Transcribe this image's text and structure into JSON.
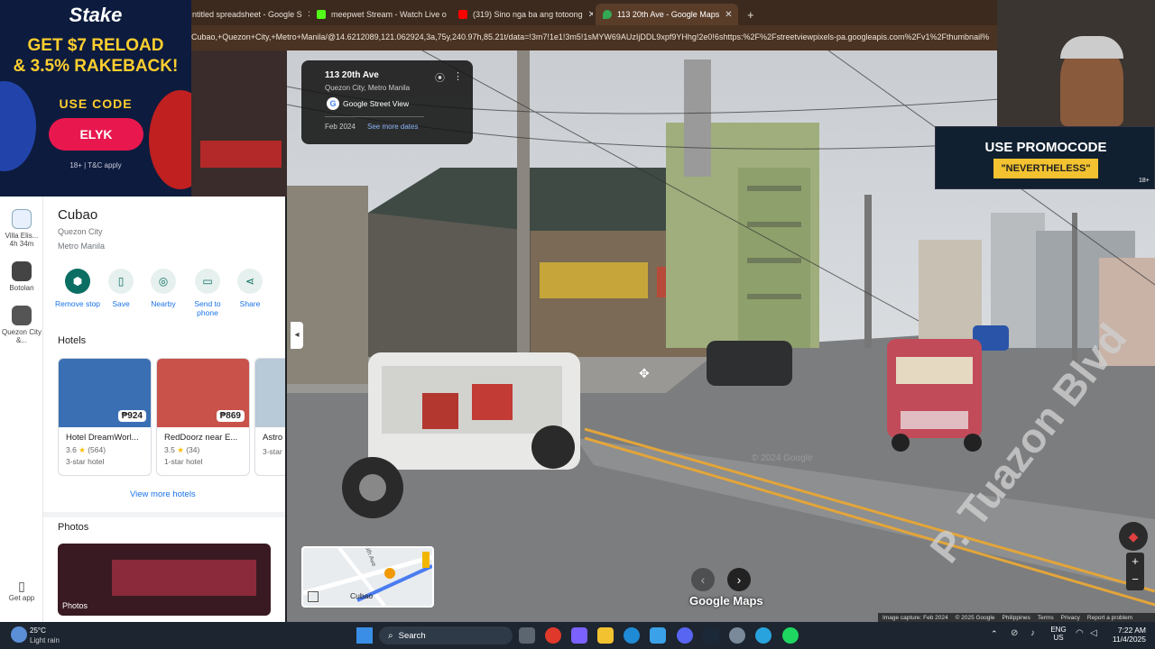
{
  "browser": {
    "tabs": [
      {
        "label": "ntitled spreadsheet - Google S",
        "active": false
      },
      {
        "label": "meepwet Stream - Watch Live o",
        "active": false
      },
      {
        "label": "(319) Sino nga ba ang totoong",
        "active": false
      },
      {
        "label": "113 20th Ave - Google Maps",
        "active": true
      }
    ],
    "new_tab": "+",
    "url": "Cubao,+Quezon+City,+Metro+Manila/@14.6212089,121.062924,3a,75y,240.97h,85.21t/data=!3m7!1e1!3m5!1sMYW69AUzIjDDL9xpf9YHhg!2e0!6shttps:%2F%2Fstreetviewpixels-pa.googleapis.com%2Fv1%2Fthumbnail%"
  },
  "ad": {
    "brand": "Stake",
    "line1": "GET $7 RELOAD",
    "line2": "& 3.5% RAKEBACK!",
    "use_code": "USE CODE",
    "code": "ELYK",
    "fine": "18+ | T&C apply"
  },
  "rail": {
    "items": [
      {
        "label": "Villa Elis...",
        "sub": "4h 34m"
      },
      {
        "label": "Botolan",
        "sub": ""
      },
      {
        "label": "Quezon City &...",
        "sub": ""
      }
    ],
    "get_app": "Get app"
  },
  "place": {
    "title": "Cubao",
    "line1": "Quezon City",
    "line2": "Metro Manila"
  },
  "actions": [
    {
      "label": "Remove stop"
    },
    {
      "label": "Save"
    },
    {
      "label": "Nearby"
    },
    {
      "label": "Send to phone"
    },
    {
      "label": "Share"
    }
  ],
  "hotels": {
    "heading": "Hotels",
    "cards": [
      {
        "name": "Hotel DreamWorl...",
        "rating": "3.6",
        "reviews": "(564)",
        "class": "3-star hotel",
        "price": "₱924",
        "color": "#3b6fb3"
      },
      {
        "name": "RedDoorz near E...",
        "rating": "3.5",
        "reviews": "(34)",
        "class": "1-star hotel",
        "price": "₱869",
        "color": "#c9524b"
      },
      {
        "name": "Astro",
        "rating": "",
        "reviews": "",
        "class": "3-star",
        "price": "",
        "color": "#b8c9d8"
      }
    ],
    "view_more": "View more hotels"
  },
  "photos": {
    "heading": "Photos",
    "caption": "Photos"
  },
  "streetview": {
    "address": "113 20th Ave",
    "locality": "Quezon City, Metro Manila",
    "source": "Google Street View",
    "date": "Feb 2024",
    "see_more": "See more dates",
    "street_label": "P. Tuazon Blvd",
    "watermark": "© 2024 Google",
    "brand": "Google Maps",
    "minimap_label": "Cubao",
    "minimap_street": "15th Ave",
    "footer": [
      "Image capture: Feb 2024",
      "© 2025 Google",
      "Philippines",
      "Terms",
      "Privacy",
      "Report a problem"
    ],
    "zoom_in": "+",
    "zoom_out": "−"
  },
  "overlays": {
    "promo_line1": "USE PROMOCODE",
    "promo_line2": "\"NEVERTHELESS\"",
    "promo_badge": "18+"
  },
  "taskbar": {
    "weather_temp": "25°C",
    "weather_desc": "Light rain",
    "search": "Search",
    "lang1": "ENG",
    "lang2": "US",
    "time": "7:22 AM",
    "date": "11/4/2025"
  }
}
